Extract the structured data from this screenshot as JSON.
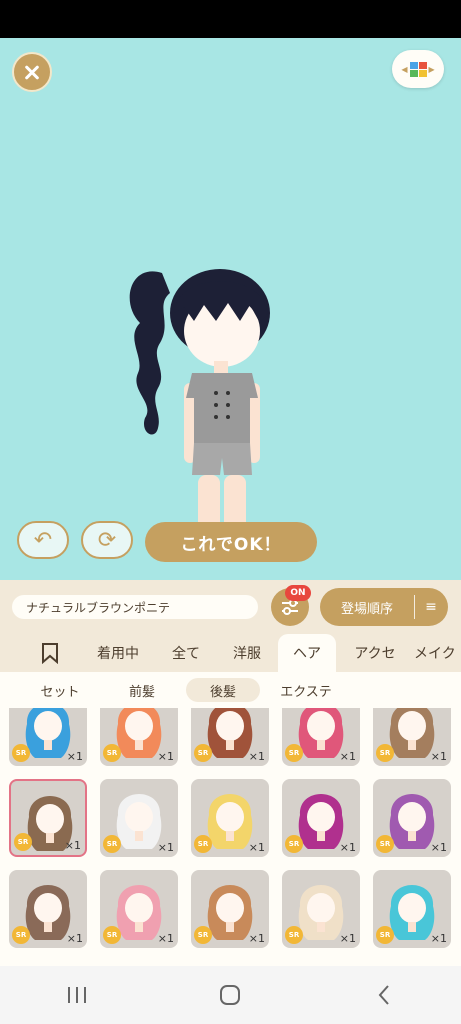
{
  "toolbar": {
    "ok_label": "これでOK！"
  },
  "item_name": "ナチュラルブラウンポニテ",
  "filter": {
    "on_badge": "ON",
    "sort_label": "登場順序"
  },
  "category_tabs": [
    "着用中",
    "全て",
    "洋服",
    "ヘア",
    "アクセ",
    "メイク"
  ],
  "active_category": "ヘア",
  "sub_tabs": [
    "セット",
    "前髪",
    "後髪",
    "エクステ"
  ],
  "active_sub_tab": "後髪",
  "rarity_label": "SR",
  "items": [
    {
      "qty": "×1",
      "hair": "#3aa0dd"
    },
    {
      "qty": "×1",
      "hair": "#f28a5a"
    },
    {
      "qty": "×1",
      "hair": "#a0533a"
    },
    {
      "qty": "×1",
      "hair": "#e0577a"
    },
    {
      "qty": "×1",
      "hair": "#a47e5e"
    },
    {
      "qty": "×1",
      "hair": "#8a6a50"
    },
    {
      "qty": "×1",
      "hair": "#f2f2f2"
    },
    {
      "qty": "×1",
      "hair": "#f3d56a"
    },
    {
      "qty": "×1",
      "hair": "#b0308e"
    },
    {
      "qty": "×1",
      "hair": "#a05ab0"
    },
    {
      "qty": "×1",
      "hair": "#8a6a58"
    },
    {
      "qty": "×1",
      "hair": "#f0a0b0"
    },
    {
      "qty": "×1",
      "hair": "#c88a5a"
    },
    {
      "qty": "×1",
      "hair": "#f0e0c8"
    },
    {
      "qty": "×1",
      "hair": "#49c6d8"
    }
  ],
  "selected_index": 5,
  "colors": {
    "stage_bg": "#a8e6e4",
    "accent_gold": "#c5a060",
    "panel_bg": "#f2e9d9",
    "badge_red": "#e8473e",
    "sr_yellow": "#f2b736",
    "selection_pink": "#e37386"
  }
}
